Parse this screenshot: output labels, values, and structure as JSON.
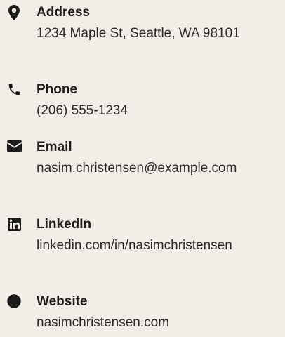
{
  "contact": {
    "items": [
      {
        "icon": "map-pin-icon",
        "label": "Address",
        "value": "1234 Maple St, Seattle, WA 98101"
      },
      {
        "icon": "phone-icon",
        "label": "Phone",
        "value": "(206) 555-1234"
      },
      {
        "icon": "envelope-icon",
        "label": "Email",
        "value": "nasim.christensen@example.com"
      },
      {
        "icon": "linkedin-icon",
        "label": "LinkedIn",
        "value": "linkedin.com/in/nasimchristensen"
      },
      {
        "icon": "globe-icon",
        "label": "Website",
        "value": "nasimchristensen.com"
      }
    ]
  },
  "colors": {
    "background": "#f2eee7",
    "text": "#2a2a2a",
    "icon": "#1b1b1b"
  }
}
